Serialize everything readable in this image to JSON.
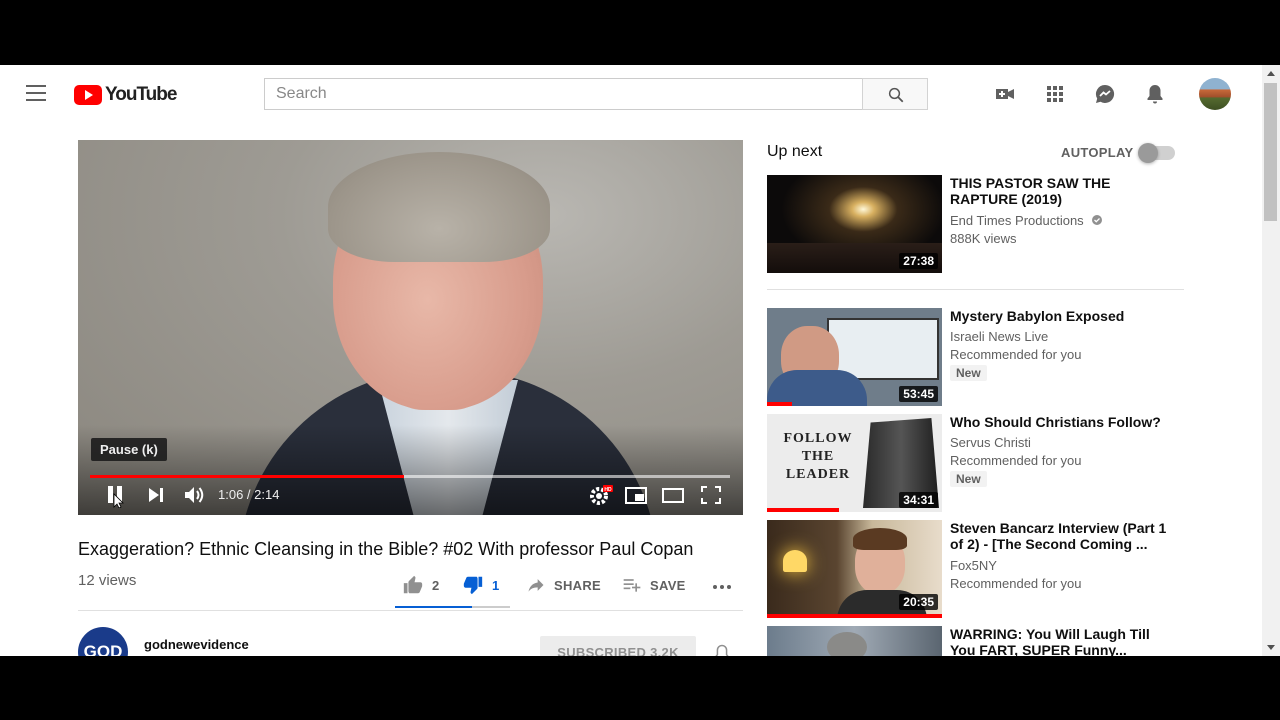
{
  "header": {
    "logo_text": "YouTube",
    "search_placeholder": "Search"
  },
  "player": {
    "tooltip": "Pause (k)",
    "current_time": "1:06",
    "duration": "2:14",
    "time_display": "1:06 / 2:14",
    "progress_fraction": 0.49,
    "buffered_fraction": 1.0
  },
  "video": {
    "title": "Exaggeration? Ethnic Cleansing in the Bible? #02 With professor Paul Copan",
    "views": "12 views",
    "likes": "2",
    "dislikes": "1",
    "like_ratio": 0.667,
    "share_label": "SHARE",
    "save_label": "SAVE",
    "channel_name": "godnewevidence",
    "channel_avatar_text": "GOD",
    "subscribe_label": "SUBSCRIBED 3.2K"
  },
  "sidebar": {
    "up_next_label": "Up next",
    "autoplay_label": "AUTOPLAY",
    "autoplay_on": false,
    "items": [
      {
        "title": "THIS PASTOR SAW THE RAPTURE (2019)",
        "channel": "End Times Productions",
        "verified": true,
        "meta": "888K views",
        "duration": "27:38",
        "new": "",
        "watched_fraction": 0
      },
      {
        "title": "Mystery Babylon Exposed",
        "channel": "Israeli News Live",
        "meta": "Recommended for you",
        "duration": "53:45",
        "new": "New",
        "watched_fraction": 0.14
      },
      {
        "title": "Who Should Christians Follow?",
        "channel": "Servus Christi",
        "meta": "Recommended for you",
        "duration": "34:31",
        "new": "New",
        "watched_fraction": 0.41,
        "thumb_text": "FOLLOW THE LEADER"
      },
      {
        "title": "Steven Bancarz Interview (Part 1 of 2) - [The Second Coming ...",
        "channel": "Fox5NY",
        "meta": "Recommended for you",
        "duration": "20:35",
        "new": "",
        "watched_fraction": 1.0
      },
      {
        "title": "WARRING: You Will Laugh Till You FART, SUPER Funny...",
        "channel": "",
        "meta": "",
        "duration": "",
        "new": "",
        "watched_fraction": 0
      }
    ]
  },
  "colors": {
    "brand_red": "#ff0000",
    "link_blue": "#065fd4",
    "text_primary": "#0f0f0f",
    "text_secondary": "#606060"
  }
}
